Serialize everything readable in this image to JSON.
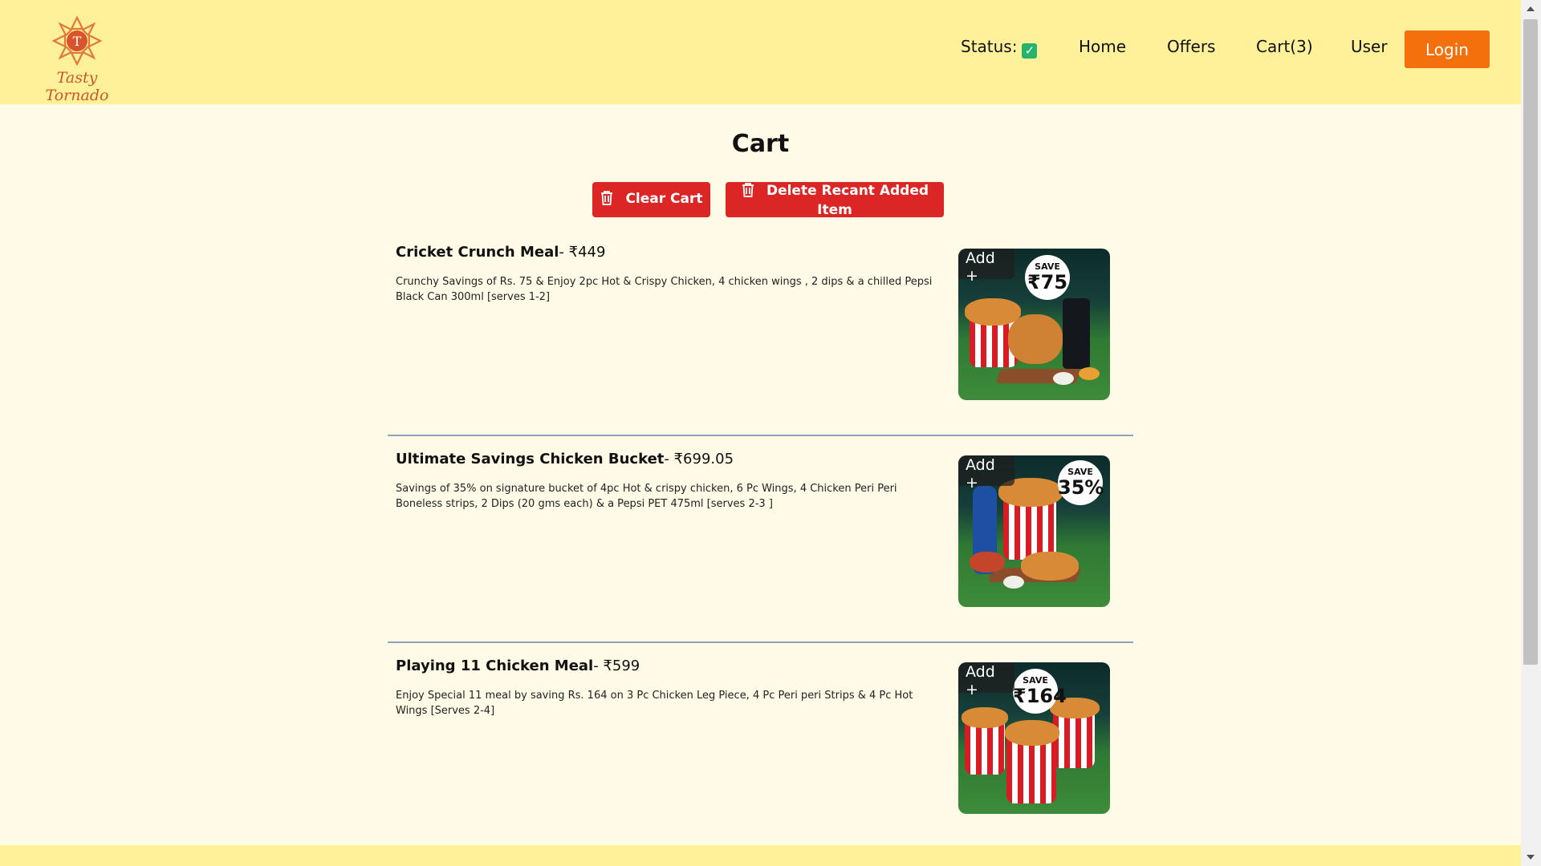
{
  "brand": {
    "name": "Tasty Tornado",
    "logo_icon": "tornado-pizza-logo-icon"
  },
  "nav": {
    "status_label": "Status:",
    "status_icon": "checkbox-checked-icon",
    "home": "Home",
    "offers": "Offers",
    "cart": "Cart(3)",
    "user": "User",
    "login": "Login"
  },
  "page": {
    "title": "Cart",
    "clear_cart": "Clear Cart",
    "delete_recent": "Delete Recant Added Item"
  },
  "items": [
    {
      "title": "Cricket Crunch Meal",
      "price": "- ₹449",
      "description": "Crunchy Savings of Rs. 75 & Enjoy 2pc Hot & Crispy Chicken, 4 chicken wings , 2 dips & a chilled Pepsi Black Can 300ml [serves 1-2]",
      "add_label": "Add +",
      "badge_top": "SAVE",
      "badge_value": "₹75"
    },
    {
      "title": "Ultimate Savings Chicken Bucket",
      "price": "- ₹699.05",
      "description": "Savings of 35% on signature bucket of 4pc Hot & crispy chicken, 6 Pc Wings, 4 Chicken Peri Peri Boneless strips, 2 Dips (20 gms each) & a Pepsi PET 475ml [serves 2-3 ]",
      "add_label": "Add +",
      "badge_top": "SAVE",
      "badge_value": "35%"
    },
    {
      "title": "Playing 11 Chicken Meal",
      "price": "- ₹599",
      "description": "Enjoy Special 11 meal by saving Rs. 164 on 3 Pc Chicken Leg Piece, 4 Pc Peri peri Strips & 4 Pc Hot Wings [Serves 2-4]",
      "add_label": "Add +",
      "badge_top": "SAVE",
      "badge_value": "₹164"
    }
  ],
  "colors": {
    "header_bg": "#fff09a",
    "page_bg": "#fffbe6",
    "accent_orange": "#f4700d",
    "danger_red": "#dc2626",
    "status_green": "#26b36b"
  }
}
